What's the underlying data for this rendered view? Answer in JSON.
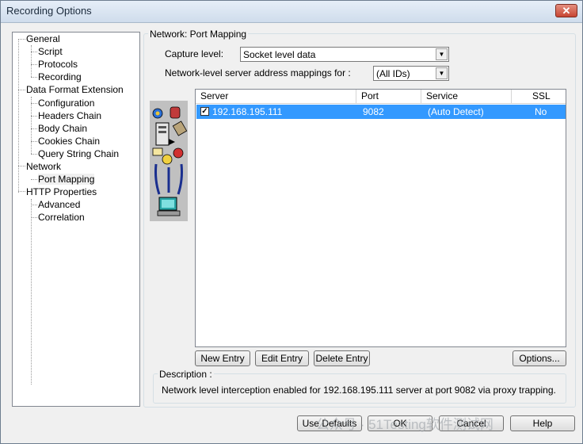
{
  "window": {
    "title": "Recording Options",
    "close_glyph": "✕"
  },
  "tree": {
    "items": [
      {
        "label": "General",
        "level": 0
      },
      {
        "label": "Script",
        "level": 1
      },
      {
        "label": "Protocols",
        "level": 1
      },
      {
        "label": "Recording",
        "level": 1
      },
      {
        "label": "Data Format Extension",
        "level": 0
      },
      {
        "label": "Configuration",
        "level": 1
      },
      {
        "label": "Headers Chain",
        "level": 1
      },
      {
        "label": "Body Chain",
        "level": 1
      },
      {
        "label": "Cookies Chain",
        "level": 1
      },
      {
        "label": "Query String Chain",
        "level": 1
      },
      {
        "label": "Network",
        "level": 0
      },
      {
        "label": "Port Mapping",
        "level": 1,
        "selected": true
      },
      {
        "label": "HTTP Properties",
        "level": 0
      },
      {
        "label": "Advanced",
        "level": 1
      },
      {
        "label": "Correlation",
        "level": 1
      }
    ]
  },
  "panel": {
    "title": "Network: Port Mapping",
    "capture_label": "Capture level:",
    "capture_value": "Socket level data",
    "mappings_label": "Network-level server address mappings for :",
    "mappings_value": "(All IDs)"
  },
  "grid": {
    "columns": [
      "Server",
      "Port",
      "Service",
      "SSL"
    ],
    "rows": [
      {
        "checked": true,
        "server": "192.168.195.111",
        "port": "9082",
        "service": "(Auto Detect)",
        "ssl": "No"
      }
    ]
  },
  "buttons": {
    "new_entry": "New Entry",
    "edit_entry": "Edit Entry",
    "delete_entry": "Delete Entry",
    "options": "Options...",
    "use_defaults": "Use Defaults",
    "ok": "OK",
    "cancel": "Cancel",
    "help": "Help"
  },
  "description": {
    "label": "Description :",
    "text": "Network level interception enabled for 192.168.195.111 server at port 9082 via proxy trapping."
  },
  "watermark": "公众号 · 51Testing软件测试网",
  "icons": [
    "close-icon",
    "dropdown-arrow-icon",
    "network-illustration-icon",
    "checkbox-icon"
  ]
}
